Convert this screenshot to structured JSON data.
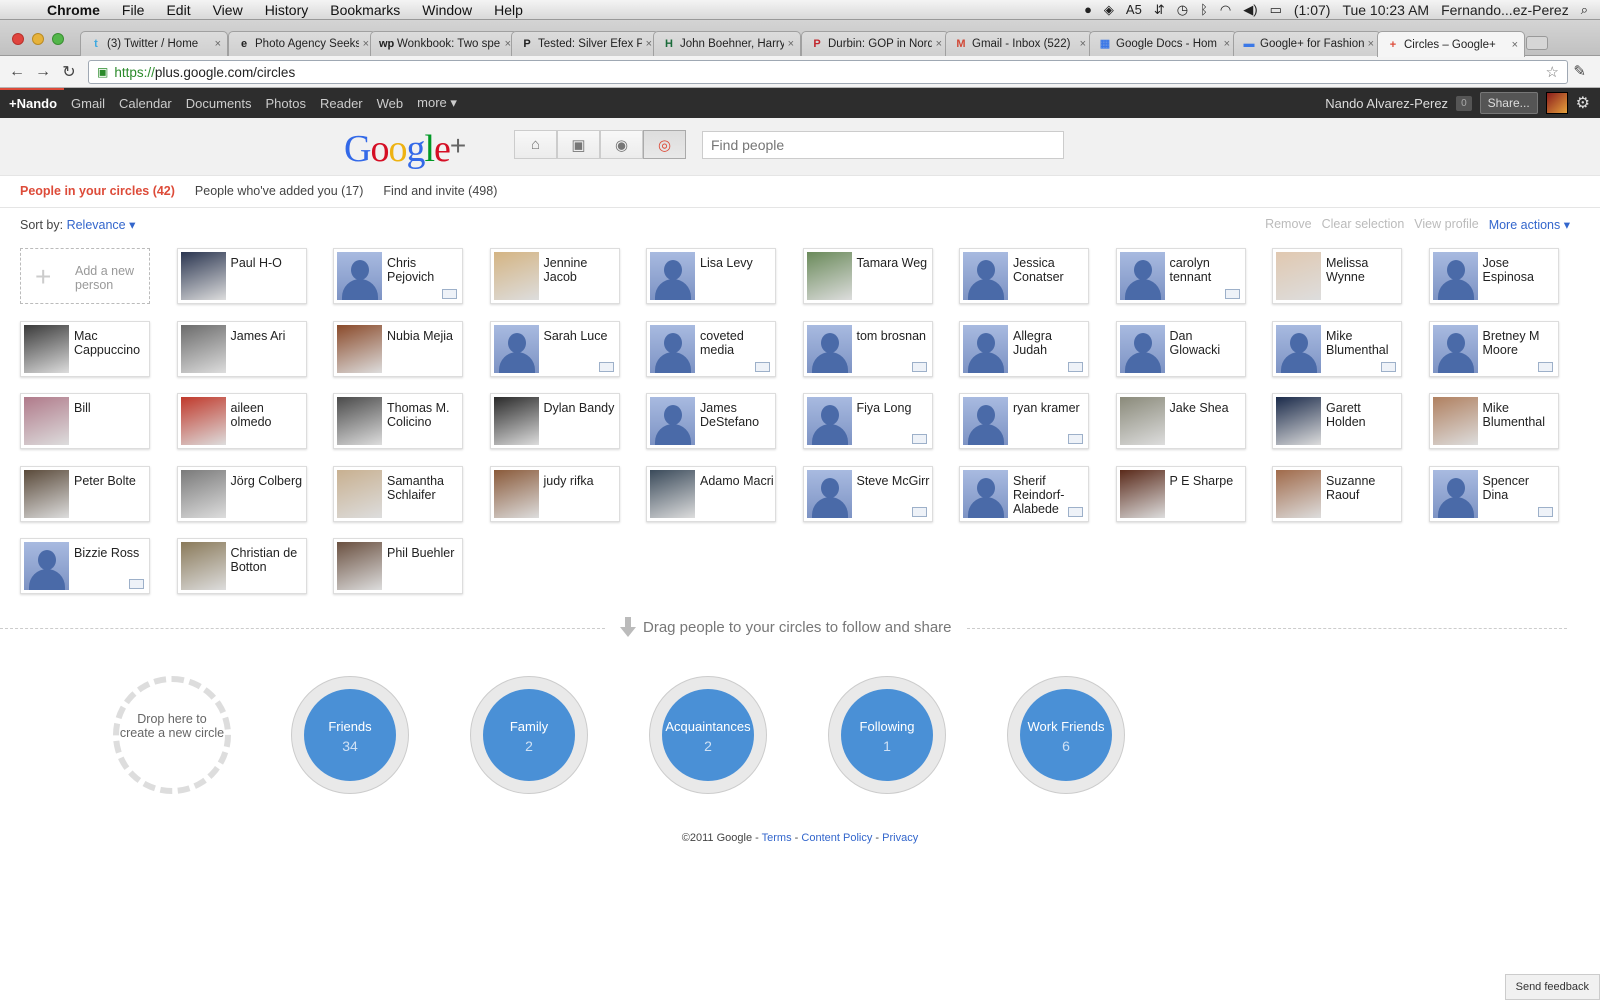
{
  "menubar": {
    "app": "Chrome",
    "items": [
      "File",
      "Edit",
      "View",
      "History",
      "Bookmarks",
      "Window",
      "Help"
    ],
    "battery": "(1:07)",
    "clock": "Tue 10:23 AM",
    "user": "Fernando...ez-Perez",
    "adobe_count": "5"
  },
  "tabs": [
    {
      "title": "(3) Twitter / Home",
      "icon": "twitter-icon",
      "glyph": "t",
      "color": "#3ea9e0"
    },
    {
      "title": "Photo Agency Seeks",
      "icon": "techcrunch-icon",
      "glyph": "e",
      "color": "#222"
    },
    {
      "title": "Wonkbook: Two spe",
      "icon": "wp-icon",
      "glyph": "wp",
      "color": "#222"
    },
    {
      "title": "Tested: Silver Efex P",
      "icon": "p-icon",
      "glyph": "P",
      "color": "#222"
    },
    {
      "title": "John Boehner, Harry",
      "icon": "huffpo-icon",
      "glyph": "H",
      "color": "#1a6b3a"
    },
    {
      "title": "Durbin: GOP in Norq",
      "icon": "politico-icon",
      "glyph": "P",
      "color": "#c1272d"
    },
    {
      "title": "Gmail - Inbox (522)",
      "icon": "gmail-icon",
      "glyph": "M",
      "color": "#d14836"
    },
    {
      "title": "Google Docs - Hom",
      "icon": "docs-icon",
      "glyph": "▦",
      "color": "#3b78e7"
    },
    {
      "title": "Google+ for Fashion",
      "icon": "folder-icon",
      "glyph": "▬",
      "color": "#3b78e7"
    },
    {
      "title": "Circles – Google+",
      "icon": "gplus-icon",
      "glyph": "+",
      "color": "#dd4b39"
    }
  ],
  "url": {
    "scheme": "https://",
    "rest": "plus.google.com/circles"
  },
  "gbar": {
    "me": "+Nando",
    "links": [
      "Gmail",
      "Calendar",
      "Documents",
      "Photos",
      "Reader",
      "Web",
      "more ▾"
    ],
    "name": "Nando Alvarez-Perez",
    "notif": "0",
    "share": "Share..."
  },
  "header": {
    "logo": "Google",
    "search_placeholder": "Find people"
  },
  "subnav": {
    "in_circles": "People in your circles (42)",
    "added_you": "People who've added you (17)",
    "find_invite": "Find and invite (498)"
  },
  "sort": {
    "label": "Sort by:",
    "value": "Relevance ▾"
  },
  "actions": {
    "remove": "Remove",
    "clear": "Clear selection",
    "view": "View profile",
    "more": "More actions ▾"
  },
  "add_person": "Add a new person",
  "people": [
    {
      "name": "Paul H-O",
      "photo": "#2a3550"
    },
    {
      "name": "Chris Pejovich",
      "photo": "",
      "mail": true
    },
    {
      "name": "Jennine Jacob",
      "photo": "#d4b483"
    },
    {
      "name": "Lisa Levy",
      "photo": ""
    },
    {
      "name": "Tamara Weg",
      "photo": "#6a8a5a"
    },
    {
      "name": "Jessica Conatser",
      "photo": ""
    },
    {
      "name": "carolyn tennant",
      "photo": "",
      "mail": true
    },
    {
      "name": "Melissa Wynne",
      "photo": "#e0c8b0"
    },
    {
      "name": "Jose Espinosa",
      "photo": ""
    },
    {
      "name": "Mac Cappuccino",
      "photo": "#3a3a3a"
    },
    {
      "name": "James Ari",
      "photo": "#6b6b6b"
    },
    {
      "name": "Nubia Mejia",
      "photo": "#8a4a2a"
    },
    {
      "name": "Sarah Luce",
      "photo": "",
      "mail": true
    },
    {
      "name": "coveted media",
      "photo": "",
      "mail": true
    },
    {
      "name": "tom brosnan",
      "photo": "",
      "mail": true
    },
    {
      "name": "Allegra Judah",
      "photo": "",
      "mail": true
    },
    {
      "name": "Dan Glowacki",
      "photo": ""
    },
    {
      "name": "Mike Blumenthal",
      "photo": "",
      "mail": true
    },
    {
      "name": "Bretney M Moore",
      "photo": "",
      "mail": true
    },
    {
      "name": "Bill",
      "photo": "#b07a8a"
    },
    {
      "name": "aileen olmedo",
      "photo": "#c0392b"
    },
    {
      "name": "Thomas M. Colicino",
      "photo": "#4a4a4a"
    },
    {
      "name": "Dylan Bandy",
      "photo": "#2a2a2a"
    },
    {
      "name": "James DeStefano",
      "photo": ""
    },
    {
      "name": "Fiya Long",
      "photo": "",
      "mail": true
    },
    {
      "name": "ryan kramer",
      "photo": "",
      "mail": true
    },
    {
      "name": "Jake Shea",
      "photo": "#8a8a7a"
    },
    {
      "name": "Garett Holden",
      "photo": "#1a2a4a"
    },
    {
      "name": "Mike Blumenthal",
      "photo": "#b08060"
    },
    {
      "name": "Peter Bolte",
      "photo": "#5a4a3a"
    },
    {
      "name": "Jörg Colberg",
      "photo": "#7a7a7a"
    },
    {
      "name": "Samantha Schlaifer",
      "photo": "#c8b090"
    },
    {
      "name": "judy rifka",
      "photo": "#8a5a3a"
    },
    {
      "name": "Adamo Macri",
      "photo": "#3a4a5a"
    },
    {
      "name": "Steve McGirr",
      "photo": "",
      "mail": true
    },
    {
      "name": "Sherif Reindorf-Alabede",
      "photo": "",
      "mail": true
    },
    {
      "name": "P E Sharpe",
      "photo": "#5a2a1a"
    },
    {
      "name": "Suzanne Raouf",
      "photo": "#a06a4a"
    },
    {
      "name": "Spencer Dina",
      "photo": "",
      "mail": true
    },
    {
      "name": "Bizzie Ross",
      "photo": "",
      "mail": true
    },
    {
      "name": "Christian de Botton",
      "photo": "#8a7a5a"
    },
    {
      "name": "Phil Buehler",
      "photo": "#6a5040"
    }
  ],
  "drag_text": "Drag people to your circles to follow and share",
  "new_circle": "Drop here to create a new circle",
  "circles": [
    {
      "name": "Friends",
      "count": "34"
    },
    {
      "name": "Family",
      "count": "2"
    },
    {
      "name": "Acquaintances",
      "count": "2"
    },
    {
      "name": "Following",
      "count": "1"
    },
    {
      "name": "Work Friends",
      "count": "6"
    }
  ],
  "footer": {
    "copy": "©2011 Google -",
    "terms": "Terms",
    "policy": "Content Policy",
    "privacy": "Privacy",
    "sep": "-"
  },
  "feedback": "Send feedback",
  "colors": {
    "accent": "#dd4b39",
    "link": "#3366cc",
    "circle": "#4a90d6"
  }
}
